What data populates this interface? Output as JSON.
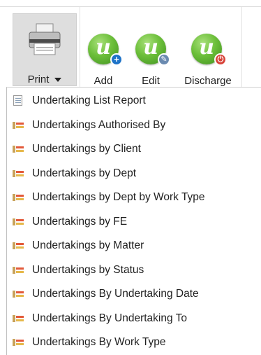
{
  "toolbar": {
    "print_label": "Print",
    "add_label": "Add",
    "edit_label": "Edit",
    "discharge_label": "Discharge",
    "ball_glyph": "u",
    "add_badge": "+",
    "edit_badge": "✎",
    "discharge_badge": "⏻",
    "colors": {
      "ball_green": "#6cbf3a",
      "add_badge": "#1e73c8",
      "edit_badge": "#6a8ab0",
      "discharge_badge": "#d8443a"
    }
  },
  "menu": {
    "items": [
      {
        "label": "Undertaking List Report",
        "icon": "report-icon"
      },
      {
        "label": "Undertakings Authorised By",
        "icon": "list-report-icon"
      },
      {
        "label": "Undertakings by Client",
        "icon": "list-report-icon"
      },
      {
        "label": "Undertakings by Dept",
        "icon": "list-report-icon"
      },
      {
        "label": "Undertakings by Dept by Work Type",
        "icon": "list-report-icon"
      },
      {
        "label": "Undertakings by FE",
        "icon": "list-report-icon"
      },
      {
        "label": "Undertakings by Matter",
        "icon": "list-report-icon"
      },
      {
        "label": "Undertakings by Status",
        "icon": "list-report-icon"
      },
      {
        "label": "Undertakings By Undertaking Date",
        "icon": "list-report-icon"
      },
      {
        "label": "Undertakings By Undertaking To",
        "icon": "list-report-icon"
      },
      {
        "label": "Undertakings By Work Type",
        "icon": "list-report-icon"
      }
    ]
  }
}
